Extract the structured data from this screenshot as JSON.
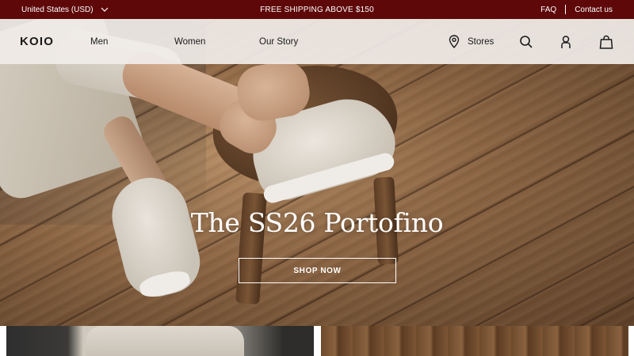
{
  "announcement": {
    "currency_label": "United States (USD)",
    "promo": "FREE SHIPPING ABOVE $150",
    "faq": "FAQ",
    "contact": "Contact us"
  },
  "header": {
    "logo": "KOIO",
    "nav": [
      "Men",
      "Women",
      "Our Story"
    ],
    "stores": "Stores",
    "icons": [
      "location-pin-icon",
      "search-icon",
      "account-icon",
      "shopping-bag-icon"
    ]
  },
  "hero": {
    "title": "The SS26 Portofino",
    "cta": "SHOP NOW"
  },
  "colors": {
    "announcement_bg": "#5e0809",
    "header_bg": "#f0ece8",
    "text": "#1a1a1a"
  }
}
